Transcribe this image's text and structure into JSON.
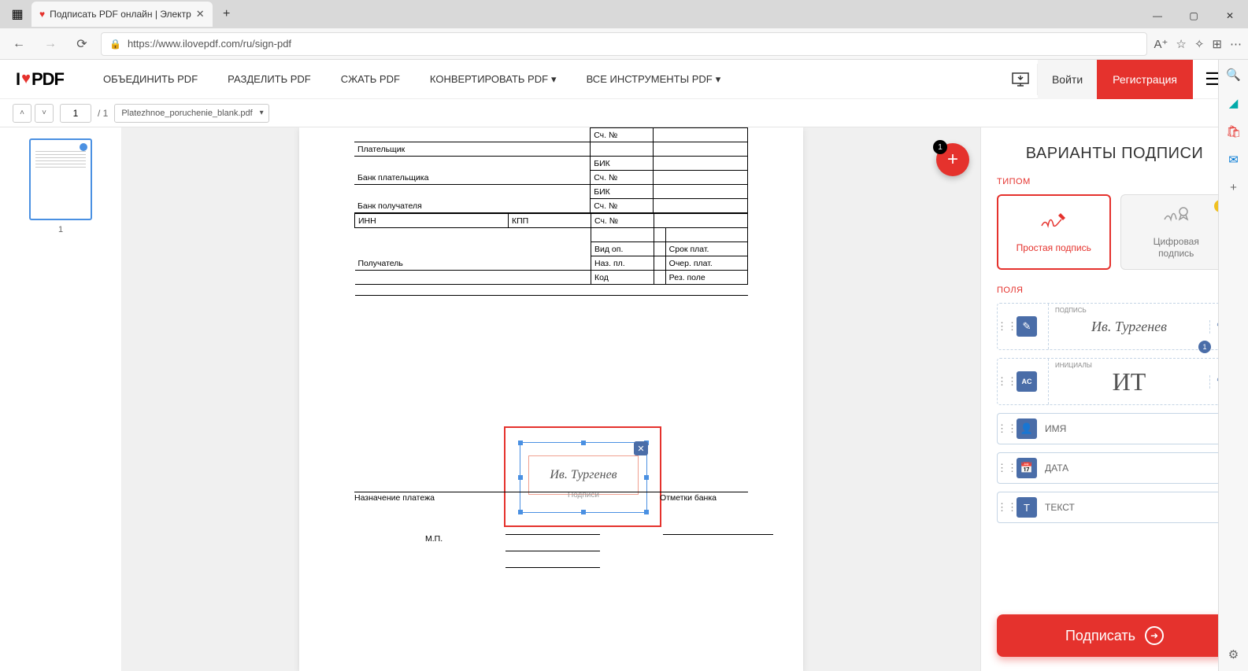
{
  "browser": {
    "tab_title": "Подписать PDF онлайн | Электр",
    "url": "https://www.ilovepdf.com/ru/sign-pdf"
  },
  "nav": {
    "merge": "ОБЪЕДИНИТЬ PDF",
    "split": "РАЗДЕЛИТЬ PDF",
    "compress": "СЖАТЬ PDF",
    "convert": "КОНВЕРТИРОВАТЬ PDF",
    "all_tools": "ВСЕ ИНСТРУМЕНТЫ PDF",
    "login": "Войти",
    "register": "Регистрация"
  },
  "logo": {
    "prefix": "I",
    "suffix": "PDF"
  },
  "toolbar": {
    "page_current": "1",
    "page_total": "/ 1",
    "filename": "Platezhnoe_poruchenie_blank.pdf"
  },
  "thumbnail": {
    "number": "1"
  },
  "fab": {
    "badge": "1"
  },
  "document": {
    "sch_no": "Сч. №",
    "payer": "Плательщик",
    "bik": "БИК",
    "payer_bank": "Банк плательщика",
    "payee_bank": "Банк получателя",
    "inn": "ИНН",
    "kpp": "КПП",
    "vid_op": "Вид оп.",
    "srok_plat": "Срок плат.",
    "naz_pl": "Наз. пл.",
    "ocher_plat": "Очер. плат.",
    "kod": "Код",
    "rez_pole": "Рез. поле",
    "payee": "Получатель",
    "purpose": "Назначение платежа",
    "bank_marks": "Отметки банка",
    "mp": "М.П.",
    "signatures_label": "Подписи",
    "signature_text": "Ив. Тургенев"
  },
  "panel": {
    "title": "ВАРИАНТЫ ПОДПИСИ",
    "type_label": "ТИПОМ",
    "simple": "Простая подпись",
    "digital_l1": "Цифровая",
    "digital_l2": "подпись",
    "fields_label": "ПОЛЯ",
    "signature_preview_label": "ПОДПИСЬ",
    "signature_preview_text": "Ив. Тургенев",
    "signature_count": "1",
    "initials_label": "ИНИЦИАЛЫ",
    "initials_text": "ИТ",
    "name": "ИМЯ",
    "date": "ДАТА",
    "text": "ТЕКСТ",
    "sign_button": "Подписать"
  }
}
